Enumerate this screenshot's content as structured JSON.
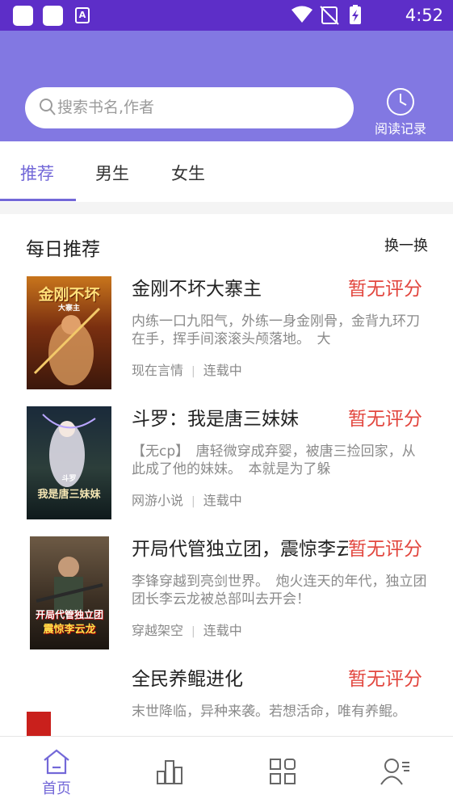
{
  "status_bar": {
    "time": "4:52",
    "a_icon_letter": "A",
    "icons": [
      "notification-square-icon",
      "notification-square-icon",
      "a-icon",
      "wifi-icon",
      "no-signal-icon",
      "battery-charging-icon"
    ]
  },
  "header": {
    "search_placeholder": "搜索书名,作者",
    "history_label": "阅读记录"
  },
  "tabs": [
    {
      "label": "推荐",
      "active": true
    },
    {
      "label": "男生",
      "active": false
    },
    {
      "label": "女生",
      "active": false
    }
  ],
  "section": {
    "title": "每日推荐",
    "refresh_label": "换一换"
  },
  "books": [
    {
      "title": "金刚不坏大寨主",
      "score": "暂无评分",
      "description": "内练一口九阳气，外练一身金刚骨，金背九环刀在手，挥手间滚滚头颅落地。　大",
      "category": "现在言情",
      "status": "连载中",
      "cover_text": "金刚不坏",
      "cover_subtext": "大寨主"
    },
    {
      "title": "斗罗：我是唐三妹妹",
      "score": "暂无评分",
      "description": "【无cp】　唐轻微穿成弃婴，被唐三捡回家，从此成了他的妹妹。　本就是为了躲",
      "category": "网游小说",
      "status": "连载中",
      "cover_text": "我是唐三妹妹",
      "cover_subtext": "斗罗"
    },
    {
      "title": "开局代管独立团，震惊李云龙",
      "score": "暂无评分",
      "description": "李锋穿越到亮剑世界。　炮火连天的年代，独立团团长李云龙被总部叫去开会！",
      "category": "穿越架空",
      "status": "连载中",
      "cover_text": "开局代管独立团",
      "cover_subtext": "震惊李云龙"
    },
    {
      "title": "全民养鲲进化",
      "score": "暂无评分",
      "description": "末世降临，异种来袭。若想活命，唯有养鲲。",
      "category": "",
      "status": "",
      "cover_text": "",
      "cover_subtext": ""
    }
  ],
  "bottom_nav": [
    {
      "label": "首页",
      "icon": "home-icon",
      "active": true
    },
    {
      "label": "",
      "icon": "ranking-icon",
      "active": false
    },
    {
      "label": "",
      "icon": "category-grid-icon",
      "active": false
    },
    {
      "label": "",
      "icon": "user-profile-icon",
      "active": false
    }
  ],
  "colors": {
    "status_bar": "#5d2ec8",
    "header": "#8278e2",
    "accent": "#7368d8",
    "score": "#e2463e"
  }
}
